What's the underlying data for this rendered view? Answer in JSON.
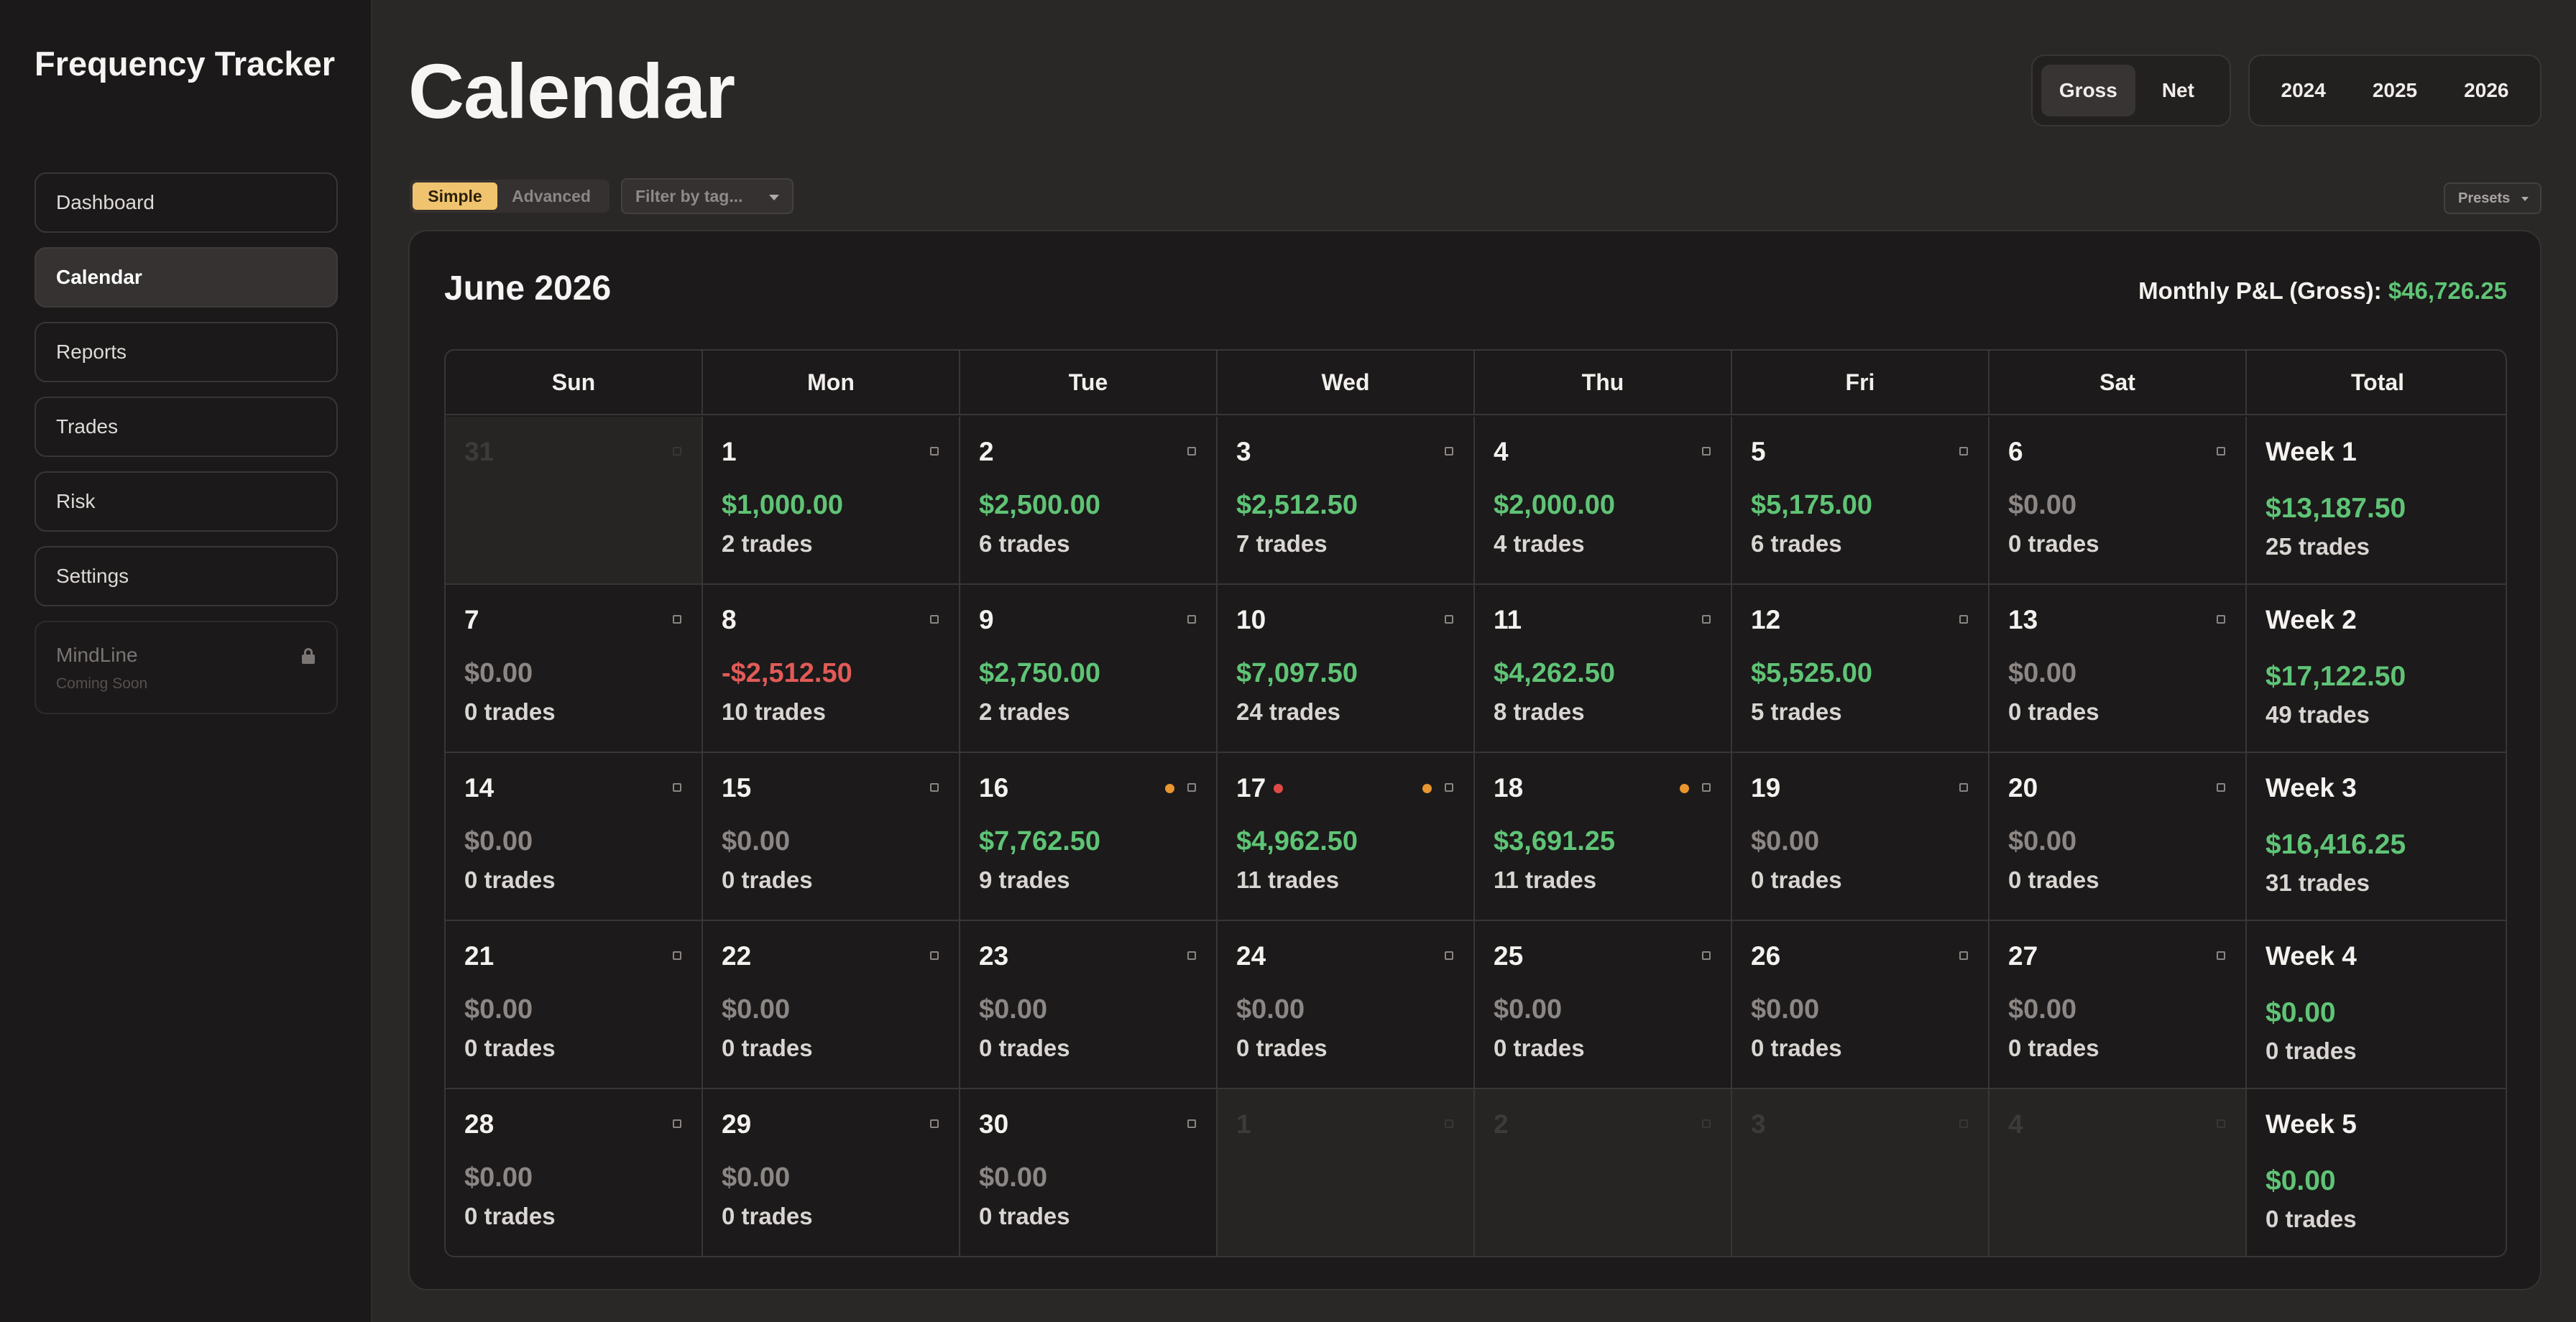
{
  "app": {
    "title": "Frequency Tracker"
  },
  "sidebar": {
    "items": [
      {
        "label": "Dashboard",
        "active": false
      },
      {
        "label": "Calendar",
        "active": true
      },
      {
        "label": "Reports",
        "active": false
      },
      {
        "label": "Trades",
        "active": false
      },
      {
        "label": "Risk",
        "active": false
      },
      {
        "label": "Settings",
        "active": false
      }
    ],
    "disabled_item": {
      "label": "MindLine",
      "sublabel": "Coming Soon",
      "icon": "lock-icon"
    }
  },
  "header": {
    "title": "Calendar",
    "pnl_mode": {
      "options": [
        "Gross",
        "Net"
      ],
      "selected": "Gross"
    },
    "years": {
      "options": [
        "2024",
        "2025",
        "2026"
      ],
      "selected": "2026"
    }
  },
  "toolbar": {
    "view_mode": {
      "options": [
        "Simple",
        "Advanced"
      ],
      "selected": "Simple"
    },
    "filter_placeholder": "Filter by tag...",
    "presets_label": "Presets"
  },
  "calendar": {
    "month_title": "June 2026",
    "monthly_pl_label": "Monthly P&L (Gross):",
    "monthly_pl_value": "$46,726.25",
    "headers": [
      "Sun",
      "Mon",
      "Tue",
      "Wed",
      "Thu",
      "Fri",
      "Sat",
      "Total"
    ],
    "weeks": [
      {
        "days": [
          {
            "day": "31",
            "outside": true
          },
          {
            "day": "1",
            "amount": "$1,000.00",
            "trades": "2 trades",
            "sign": "pos"
          },
          {
            "day": "2",
            "amount": "$2,500.00",
            "trades": "6 trades",
            "sign": "pos"
          },
          {
            "day": "3",
            "amount": "$2,512.50",
            "trades": "7 trades",
            "sign": "pos"
          },
          {
            "day": "4",
            "amount": "$2,000.00",
            "trades": "4 trades",
            "sign": "pos"
          },
          {
            "day": "5",
            "amount": "$5,175.00",
            "trades": "6 trades",
            "sign": "pos"
          },
          {
            "day": "6",
            "amount": "$0.00",
            "trades": "0 trades",
            "sign": "zero"
          }
        ],
        "total": {
          "label": "Week 1",
          "amount": "$13,187.50",
          "trades": "25 trades"
        }
      },
      {
        "days": [
          {
            "day": "7",
            "amount": "$0.00",
            "trades": "0 trades",
            "sign": "zero"
          },
          {
            "day": "8",
            "amount": "-$2,512.50",
            "trades": "10 trades",
            "sign": "neg"
          },
          {
            "day": "9",
            "amount": "$2,750.00",
            "trades": "2 trades",
            "sign": "pos"
          },
          {
            "day": "10",
            "amount": "$7,097.50",
            "trades": "24 trades",
            "sign": "pos"
          },
          {
            "day": "11",
            "amount": "$4,262.50",
            "trades": "8 trades",
            "sign": "pos"
          },
          {
            "day": "12",
            "amount": "$5,525.00",
            "trades": "5 trades",
            "sign": "pos"
          },
          {
            "day": "13",
            "amount": "$0.00",
            "trades": "0 trades",
            "sign": "zero"
          }
        ],
        "total": {
          "label": "Week 2",
          "amount": "$17,122.50",
          "trades": "49 trades"
        }
      },
      {
        "days": [
          {
            "day": "14",
            "amount": "$0.00",
            "trades": "0 trades",
            "sign": "zero"
          },
          {
            "day": "15",
            "amount": "$0.00",
            "trades": "0 trades",
            "sign": "zero"
          },
          {
            "day": "16",
            "amount": "$7,762.50",
            "trades": "9 trades",
            "sign": "pos",
            "marker": "#e8962e"
          },
          {
            "day": "17",
            "amount": "$4,962.50",
            "trades": "11 trades",
            "sign": "pos",
            "marker": "#e8962e",
            "alert": "#e04a46"
          },
          {
            "day": "18",
            "amount": "$3,691.25",
            "trades": "11 trades",
            "sign": "pos",
            "marker": "#e8962e"
          },
          {
            "day": "19",
            "amount": "$0.00",
            "trades": "0 trades",
            "sign": "zero"
          },
          {
            "day": "20",
            "amount": "$0.00",
            "trades": "0 trades",
            "sign": "zero"
          }
        ],
        "total": {
          "label": "Week 3",
          "amount": "$16,416.25",
          "trades": "31 trades"
        }
      },
      {
        "days": [
          {
            "day": "21",
            "amount": "$0.00",
            "trades": "0 trades",
            "sign": "zero"
          },
          {
            "day": "22",
            "amount": "$0.00",
            "trades": "0 trades",
            "sign": "zero"
          },
          {
            "day": "23",
            "amount": "$0.00",
            "trades": "0 trades",
            "sign": "zero"
          },
          {
            "day": "24",
            "amount": "$0.00",
            "trades": "0 trades",
            "sign": "zero"
          },
          {
            "day": "25",
            "amount": "$0.00",
            "trades": "0 trades",
            "sign": "zero"
          },
          {
            "day": "26",
            "amount": "$0.00",
            "trades": "0 trades",
            "sign": "zero"
          },
          {
            "day": "27",
            "amount": "$0.00",
            "trades": "0 trades",
            "sign": "zero"
          }
        ],
        "total": {
          "label": "Week 4",
          "amount": "$0.00",
          "trades": "0 trades"
        }
      },
      {
        "days": [
          {
            "day": "28",
            "amount": "$0.00",
            "trades": "0 trades",
            "sign": "zero"
          },
          {
            "day": "29",
            "amount": "$0.00",
            "trades": "0 trades",
            "sign": "zero"
          },
          {
            "day": "30",
            "amount": "$0.00",
            "trades": "0 trades",
            "sign": "zero"
          },
          {
            "day": "1",
            "outside": true
          },
          {
            "day": "2",
            "outside": true
          },
          {
            "day": "3",
            "outside": true
          },
          {
            "day": "4",
            "outside": true
          }
        ],
        "total": {
          "label": "Week 5",
          "amount": "$0.00",
          "trades": "0 trades"
        }
      }
    ]
  },
  "colors": {
    "positive": "#5fc476",
    "negative": "#e15b57",
    "accent": "#f0c46e",
    "background": "#2a2727"
  }
}
